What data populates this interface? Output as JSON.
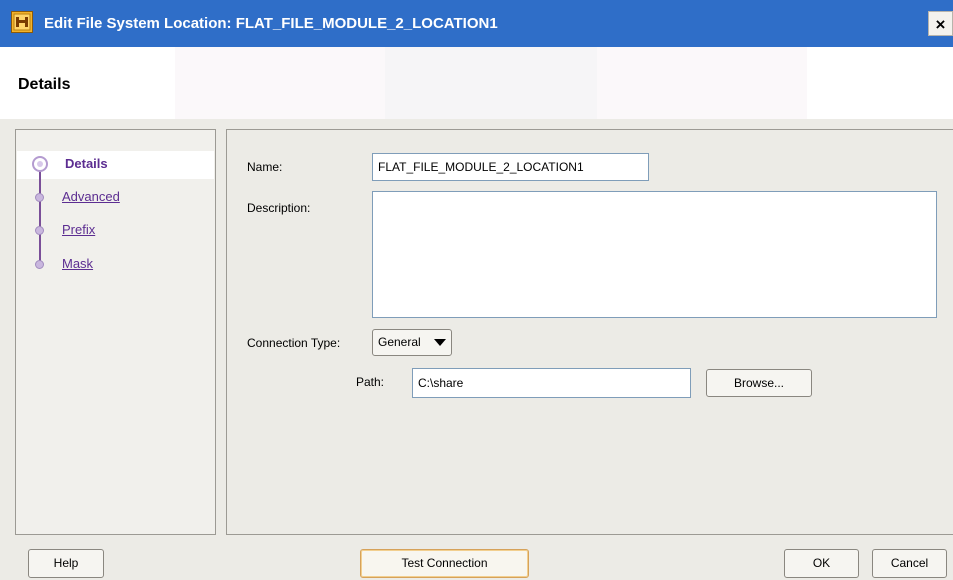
{
  "window": {
    "title": "Edit File System Location: FLAT_FILE_MODULE_2_LOCATION1",
    "close_glyph": "×",
    "app_icon": "oracle-warehouse-builder-icon"
  },
  "header": {
    "title": "Details"
  },
  "nav": {
    "items": [
      {
        "label": "Details",
        "selected": true
      },
      {
        "label": "Advanced",
        "selected": false
      },
      {
        "label": "Prefix",
        "selected": false
      },
      {
        "label": "Mask",
        "selected": false
      }
    ]
  },
  "form": {
    "name_label": "Name:",
    "name_value": "FLAT_FILE_MODULE_2_LOCATION1",
    "description_label": "Description:",
    "description_value": "",
    "connection_type_label": "Connection Type:",
    "connection_type_value": "General",
    "path_label": "Path:",
    "path_value": "C:\\share",
    "browse_label": "Browse..."
  },
  "footer": {
    "help_label": "Help",
    "test_connection_label": "Test Connection",
    "ok_label": "OK",
    "cancel_label": "Cancel"
  },
  "colors": {
    "title_bar": "#2f6ec8",
    "nav_accent": "#5c2d91",
    "dialog_background": "#ecebe6"
  }
}
